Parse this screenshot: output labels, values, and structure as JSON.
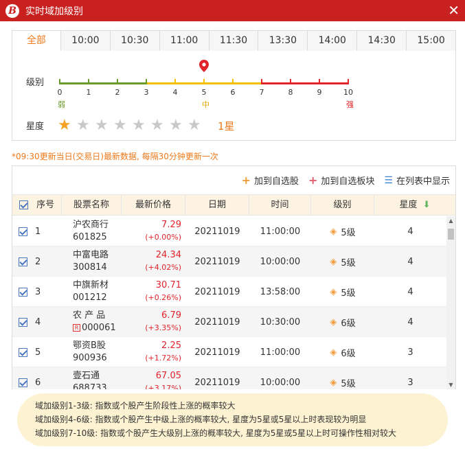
{
  "window": {
    "title": "实时域加级别",
    "logo_text": "B"
  },
  "tabs": [
    "全部",
    "10:00",
    "10:30",
    "11:00",
    "11:30",
    "13:30",
    "14:00",
    "14:30",
    "15:00"
  ],
  "level": {
    "label": "级别",
    "ticks": [
      "0",
      "1",
      "2",
      "3",
      "4",
      "5",
      "6",
      "7",
      "8",
      "9",
      "10"
    ],
    "weak": "弱",
    "mid": "中",
    "strong": "强",
    "value": 5,
    "colors": {
      "weak": "#6a9a2a",
      "mid": "#f2c200",
      "strong": "#e0242a"
    }
  },
  "stars": {
    "label": "星度",
    "value": 1,
    "max": 8,
    "text": "1星"
  },
  "note": "*09:30更新当日(交易日)最新数据, 每隔30分钟更新一次",
  "actions": {
    "add_stock": "加到自选股",
    "add_block": "加到自选板块",
    "show_list": "在列表中显示"
  },
  "columns": [
    "序号",
    "股票名称",
    "最新价格",
    "日期",
    "时间",
    "级别",
    "星度"
  ],
  "rows": [
    {
      "idx": "1",
      "name": "沪农商行",
      "code": "601825",
      "price": "7.29",
      "change": "(+0.00%)",
      "date": "20211019",
      "time": "11:00:00",
      "level": "5级",
      "star": "4"
    },
    {
      "idx": "2",
      "name": "中富电路",
      "code": "300814",
      "price": "24.34",
      "change": "(+4.02%)",
      "date": "20211019",
      "time": "10:00:00",
      "level": "5级",
      "star": "4"
    },
    {
      "idx": "3",
      "name": "中旗新材",
      "code": "001212",
      "price": "30.71",
      "change": "(+0.26%)",
      "date": "20211019",
      "time": "13:58:00",
      "level": "5级",
      "star": "4"
    },
    {
      "idx": "4",
      "name": "农 产 品",
      "code": "000061",
      "price": "6.79",
      "change": "(+3.35%)",
      "date": "20211019",
      "time": "10:30:00",
      "level": "6级",
      "star": "4",
      "tag": "R"
    },
    {
      "idx": "5",
      "name": "鄂资B股",
      "code": "900936",
      "price": "2.25",
      "change": "(+1.72%)",
      "date": "20211019",
      "time": "11:00:00",
      "level": "6级",
      "star": "3"
    },
    {
      "idx": "6",
      "name": "壹石通",
      "code": "688733",
      "price": "67.05",
      "change": "(+3.17%)",
      "date": "20211019",
      "time": "10:00:00",
      "level": "5级",
      "star": "3"
    }
  ],
  "info": [
    "域加级别1-3级: 指数或个股产生阶段性上涨的概率较大",
    "域加级别4-6级: 指数或个股产生中级上涨的概率较大, 星度为5星或5星以上时表现较为明显",
    "域加级别7-10级: 指数或个股产生大级别上涨的概率较大, 星度为5星或5星以上时可操作性相对较大"
  ]
}
